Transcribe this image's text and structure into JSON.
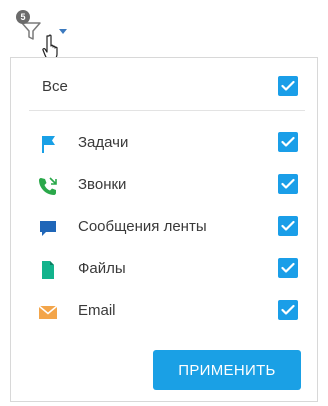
{
  "filter": {
    "badge_count": "5",
    "icon": "funnel-icon"
  },
  "options": {
    "all_label": "Все",
    "items": [
      {
        "label": "Задачи",
        "icon": "flag-icon",
        "color": "#19a0e6",
        "checked": true
      },
      {
        "label": "Звонки",
        "icon": "phone-icon",
        "color": "#2aa84a",
        "checked": true
      },
      {
        "label": "Сообщения ленты",
        "icon": "chat-icon",
        "color": "#1f66b8",
        "checked": true
      },
      {
        "label": "Файлы",
        "icon": "file-icon",
        "color": "#12b38c",
        "checked": true
      },
      {
        "label": "Email",
        "icon": "envelope-icon",
        "color": "#f3a54a",
        "checked": true
      }
    ]
  },
  "apply_button": {
    "label": "ПРИМЕНИТЬ",
    "color": "#1aa0e5"
  }
}
